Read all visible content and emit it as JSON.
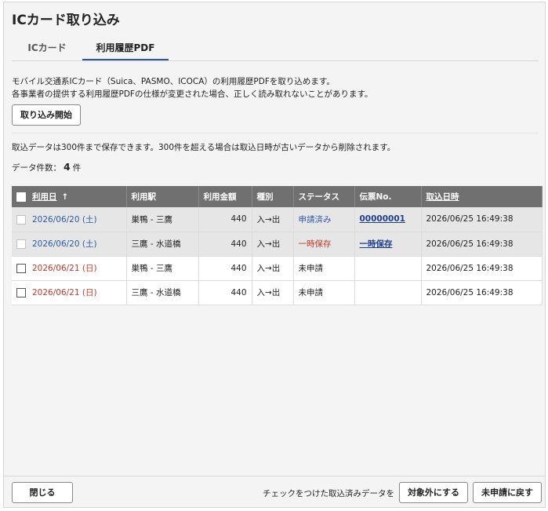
{
  "title": "ICカード取り込み",
  "tabs": [
    {
      "label": "ICカード"
    },
    {
      "label": "利用履歴PDF"
    }
  ],
  "description": {
    "line1": "モバイル交通系ICカード（Suica、PASMO、ICOCA）の利用履歴PDFを取り込めます。",
    "line2": "各事業者の提供する利用履歴PDFの仕様が変更された場合、正しく読み取れないことがあります。"
  },
  "import_button": "取り込み開始",
  "info_text": "取込データは300件まで保存できます。300件を超える場合は取込日時が古いデータから削除されます。",
  "count": {
    "label": "データ件数：",
    "value": "4",
    "unit": "件"
  },
  "table": {
    "headers": {
      "date": "利用日",
      "sort_icon": "↑",
      "station": "利用駅",
      "amount": "利用金額",
      "type": "種別",
      "status": "ステータス",
      "slip": "伝票No.",
      "imported_at": "取込日時"
    },
    "rows": [
      {
        "date": "2026/06/20 (土)",
        "station": "巣鴨 - 三鷹",
        "amount": "440",
        "type": "入→出",
        "status": "申請済み",
        "slip": "00000001",
        "imported_at": "2026/06/25 16:49:38"
      },
      {
        "date": "2026/06/20 (土)",
        "station": "三鷹 - 水道橋",
        "amount": "440",
        "type": "入→出",
        "status": "一時保存",
        "slip": "一時保存",
        "imported_at": "2026/06/25 16:49:38"
      },
      {
        "date": "2026/06/21 (日)",
        "station": "巣鴨 - 三鷹",
        "amount": "440",
        "type": "入→出",
        "status": "未申請",
        "slip": "",
        "imported_at": "2026/06/25 16:49:38"
      },
      {
        "date": "2026/06/21 (日)",
        "station": "三鷹 - 水道橋",
        "amount": "440",
        "type": "入→出",
        "status": "未申請",
        "slip": "",
        "imported_at": "2026/06/25 16:49:38"
      }
    ]
  },
  "footer": {
    "close": "閉じる",
    "text": "チェックをつけた取込済みデータを",
    "exclude": "対象外にする",
    "revert": "未申請に戻す"
  },
  "colors": {
    "accent": "#2a58a6",
    "header_bg": "#707070",
    "weekend_red": "#c0392b",
    "weekday_blue": "#2a5aa8"
  }
}
